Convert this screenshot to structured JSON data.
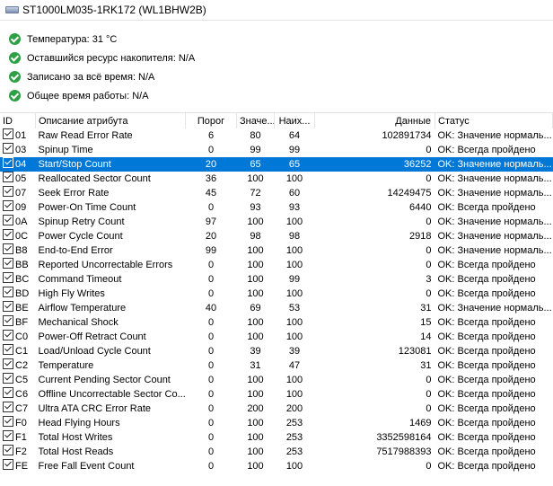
{
  "window": {
    "drive_title": "ST1000LM035-1RK172 (WL1BHW2B)"
  },
  "summary": [
    {
      "label": "Температура: 31 °C"
    },
    {
      "label": "Оставшийся ресурс накопителя: N/A"
    },
    {
      "label": "Записано за всё время: N/A"
    },
    {
      "label": "Общее время работы: N/A"
    }
  ],
  "table": {
    "headers": {
      "id": "ID",
      "desc": "Описание атрибута",
      "threshold": "Порог",
      "value": "Значе...",
      "worst": "Наих...",
      "data": "Данные",
      "status": "Статус"
    },
    "selected_row": 2,
    "rows": [
      {
        "id": "01",
        "desc": "Raw Read Error Rate",
        "thr": "6",
        "val": "80",
        "worst": "64",
        "data": "102891734",
        "status": "OK: Значение нормаль..."
      },
      {
        "id": "03",
        "desc": "Spinup Time",
        "thr": "0",
        "val": "99",
        "worst": "99",
        "data": "0",
        "status": "OK: Всегда пройдено"
      },
      {
        "id": "04",
        "desc": "Start/Stop Count",
        "thr": "20",
        "val": "65",
        "worst": "65",
        "data": "36252",
        "status": "OK: Значение нормаль..."
      },
      {
        "id": "05",
        "desc": "Reallocated Sector Count",
        "thr": "36",
        "val": "100",
        "worst": "100",
        "data": "0",
        "status": "OK: Значение нормаль..."
      },
      {
        "id": "07",
        "desc": "Seek Error Rate",
        "thr": "45",
        "val": "72",
        "worst": "60",
        "data": "14249475",
        "status": "OK: Значение нормаль..."
      },
      {
        "id": "09",
        "desc": "Power-On Time Count",
        "thr": "0",
        "val": "93",
        "worst": "93",
        "data": "6440",
        "status": "OK: Всегда пройдено"
      },
      {
        "id": "0A",
        "desc": "Spinup Retry Count",
        "thr": "97",
        "val": "100",
        "worst": "100",
        "data": "0",
        "status": "OK: Значение нормаль..."
      },
      {
        "id": "0C",
        "desc": "Power Cycle Count",
        "thr": "20",
        "val": "98",
        "worst": "98",
        "data": "2918",
        "status": "OK: Значение нормаль..."
      },
      {
        "id": "B8",
        "desc": "End-to-End Error",
        "thr": "99",
        "val": "100",
        "worst": "100",
        "data": "0",
        "status": "OK: Значение нормаль..."
      },
      {
        "id": "BB",
        "desc": "Reported Uncorrectable Errors",
        "thr": "0",
        "val": "100",
        "worst": "100",
        "data": "0",
        "status": "OK: Всегда пройдено"
      },
      {
        "id": "BC",
        "desc": "Command Timeout",
        "thr": "0",
        "val": "100",
        "worst": "99",
        "data": "3",
        "status": "OK: Всегда пройдено"
      },
      {
        "id": "BD",
        "desc": "High Fly Writes",
        "thr": "0",
        "val": "100",
        "worst": "100",
        "data": "0",
        "status": "OK: Всегда пройдено"
      },
      {
        "id": "BE",
        "desc": "Airflow Temperature",
        "thr": "40",
        "val": "69",
        "worst": "53",
        "data": "31",
        "status": "OK: Значение нормаль..."
      },
      {
        "id": "BF",
        "desc": "Mechanical Shock",
        "thr": "0",
        "val": "100",
        "worst": "100",
        "data": "15",
        "status": "OK: Всегда пройдено"
      },
      {
        "id": "C0",
        "desc": "Power-Off Retract Count",
        "thr": "0",
        "val": "100",
        "worst": "100",
        "data": "14",
        "status": "OK: Всегда пройдено"
      },
      {
        "id": "C1",
        "desc": "Load/Unload Cycle Count",
        "thr": "0",
        "val": "39",
        "worst": "39",
        "data": "123081",
        "status": "OK: Всегда пройдено"
      },
      {
        "id": "C2",
        "desc": "Temperature",
        "thr": "0",
        "val": "31",
        "worst": "47",
        "data": "31",
        "status": "OK: Всегда пройдено"
      },
      {
        "id": "C5",
        "desc": "Current Pending Sector Count",
        "thr": "0",
        "val": "100",
        "worst": "100",
        "data": "0",
        "status": "OK: Всегда пройдено"
      },
      {
        "id": "C6",
        "desc": "Offline Uncorrectable Sector Co...",
        "thr": "0",
        "val": "100",
        "worst": "100",
        "data": "0",
        "status": "OK: Всегда пройдено"
      },
      {
        "id": "C7",
        "desc": "Ultra ATA CRC Error Rate",
        "thr": "0",
        "val": "200",
        "worst": "200",
        "data": "0",
        "status": "OK: Всегда пройдено"
      },
      {
        "id": "F0",
        "desc": "Head Flying Hours",
        "thr": "0",
        "val": "100",
        "worst": "253",
        "data": "1469",
        "status": "OK: Всегда пройдено"
      },
      {
        "id": "F1",
        "desc": "Total Host Writes",
        "thr": "0",
        "val": "100",
        "worst": "253",
        "data": "3352598164",
        "status": "OK: Всегда пройдено"
      },
      {
        "id": "F2",
        "desc": "Total Host Reads",
        "thr": "0",
        "val": "100",
        "worst": "253",
        "data": "7517988393",
        "status": "OK: Всегда пройдено"
      },
      {
        "id": "FE",
        "desc": "Free Fall Event Count",
        "thr": "0",
        "val": "100",
        "worst": "100",
        "data": "0",
        "status": "OK: Всегда пройдено"
      }
    ]
  },
  "colors": {
    "ok_icon": "#2e9f45",
    "selection": "#0078d7"
  },
  "icons": {
    "drive": "drive-icon",
    "ok": "ok-check-icon",
    "checkbox": "checkbox-checked-icon"
  }
}
